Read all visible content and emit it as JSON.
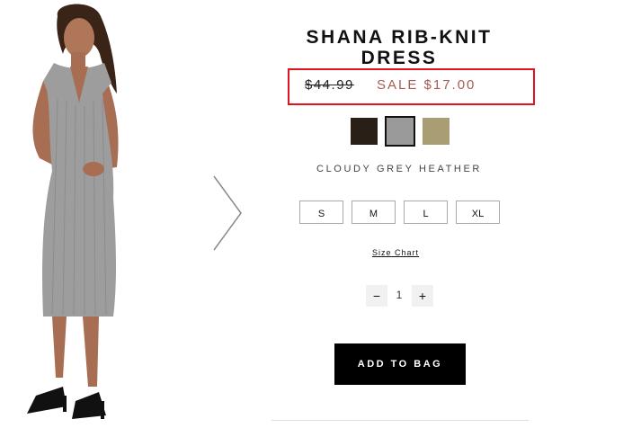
{
  "product": {
    "title": "SHANA RIB-KNIT DRESS",
    "original_price": "$44.99",
    "sale_price": "SALE $17.00",
    "color_name": "CLOUDY GREY HEATHER",
    "swatches": [
      {
        "color": "#2a1f17",
        "selected": false
      },
      {
        "color": "#9a9a9a",
        "selected": true
      },
      {
        "color": "#a99d74",
        "selected": false
      }
    ],
    "sizes": [
      "S",
      "M",
      "L",
      "XL"
    ],
    "size_chart_label": "Size Chart",
    "quantity": "1",
    "qty_minus": "−",
    "qty_plus": "+",
    "add_to_bag_label": "ADD TO BAG"
  },
  "colors": {
    "highlight_box": "#e0141e",
    "sale_text": "#a85a55",
    "button_bg": "#000000"
  }
}
